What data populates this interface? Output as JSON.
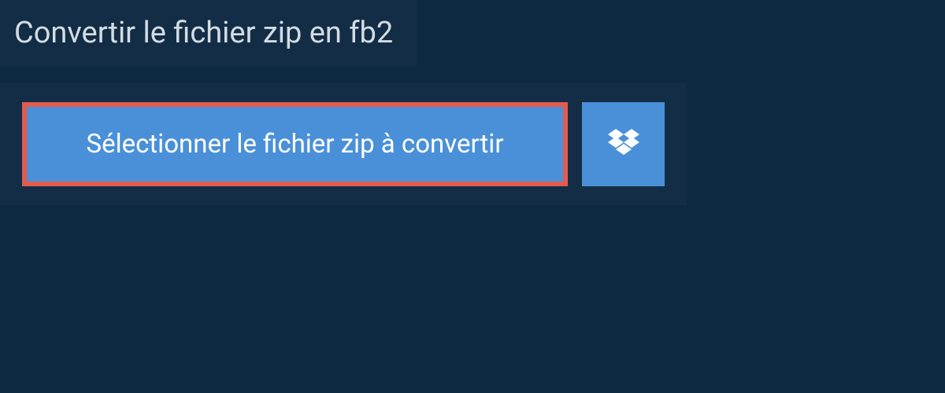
{
  "header": {
    "title": "Convertir le fichier zip en fb2"
  },
  "upload": {
    "select_button_label": "Sélectionner le fichier zip à convertir"
  }
}
